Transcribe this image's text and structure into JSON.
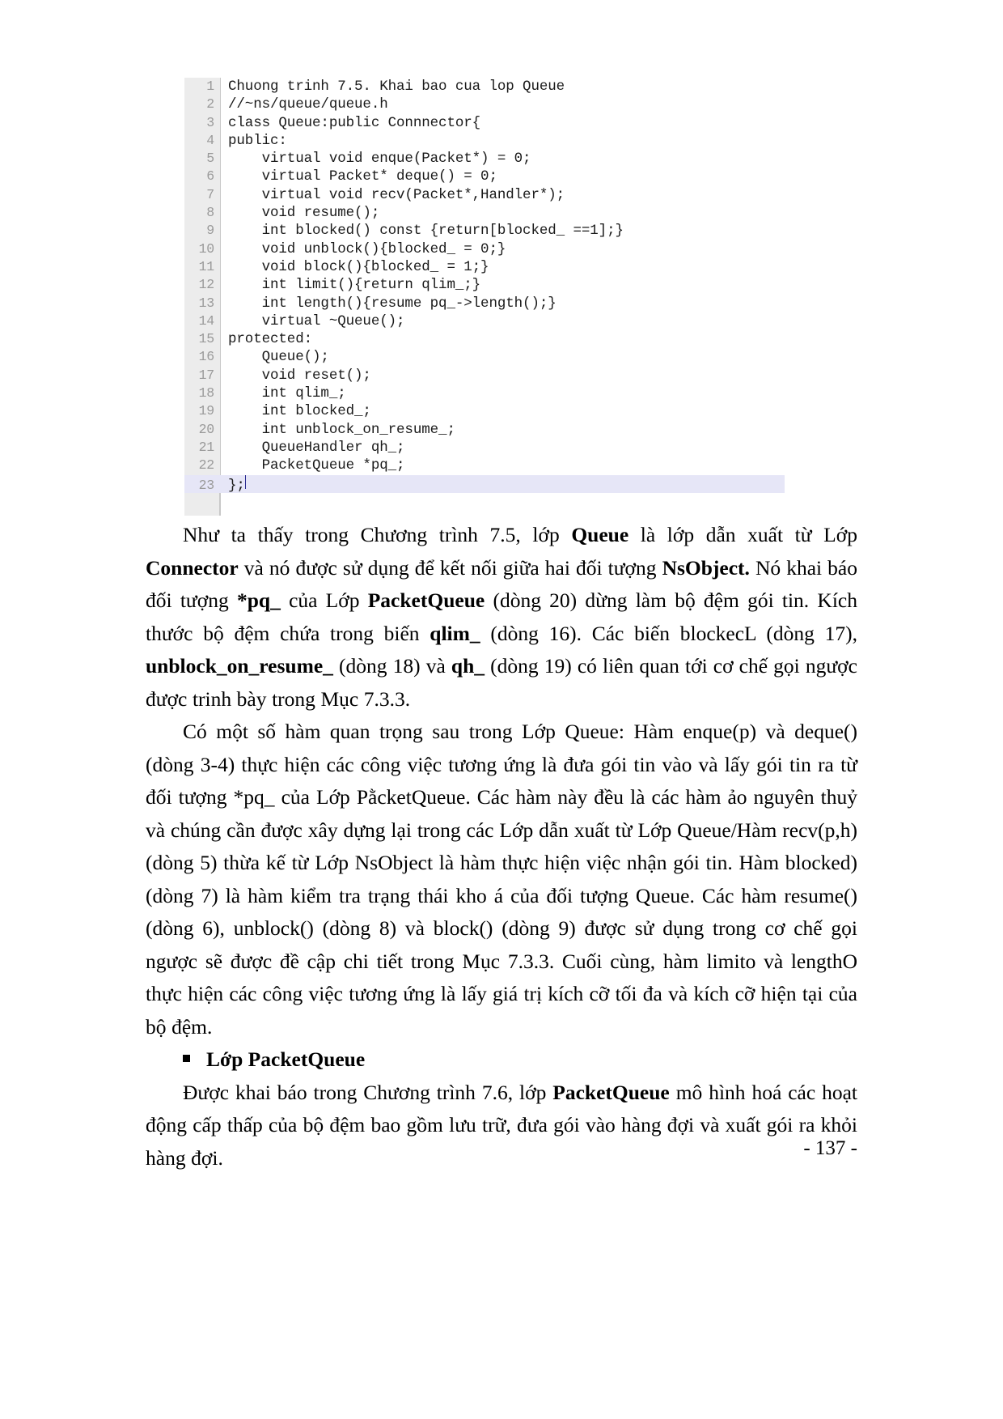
{
  "code_listing": {
    "language": "cpp",
    "highlighted_line": 23,
    "lines": [
      {
        "n": "1",
        "text": "Chuong trinh 7.5. Khai bao cua lop Queue"
      },
      {
        "n": "2",
        "text": "//~ns/queue/queue.h"
      },
      {
        "n": "3",
        "text": "class Queue:public Connnector{"
      },
      {
        "n": "4",
        "text": "public:"
      },
      {
        "n": "5",
        "text": "    virtual void enque(Packet*) = 0;"
      },
      {
        "n": "6",
        "text": "    virtual Packet* deque() = 0;"
      },
      {
        "n": "7",
        "text": "    virtual void recv(Packet*,Handler*);"
      },
      {
        "n": "8",
        "text": "    void resume();"
      },
      {
        "n": "9",
        "text": "    int blocked() const {return[blocked_ ==1];}"
      },
      {
        "n": "10",
        "text": "    void unblock(){blocked_ = 0;}"
      },
      {
        "n": "11",
        "text": "    void block(){blocked_ = 1;}"
      },
      {
        "n": "12",
        "text": "    int limit(){return qlim_;}"
      },
      {
        "n": "13",
        "text": "    int length(){resume pq_->length();}"
      },
      {
        "n": "14",
        "text": "    virtual ~Queue();"
      },
      {
        "n": "15",
        "text": "protected:"
      },
      {
        "n": "16",
        "text": "    Queue();"
      },
      {
        "n": "17",
        "text": "    void reset();"
      },
      {
        "n": "18",
        "text": "    int qlim_;"
      },
      {
        "n": "19",
        "text": "    int blocked_;"
      },
      {
        "n": "20",
        "text": "    int unblock_on_resume_;"
      },
      {
        "n": "21",
        "text": "    QueueHandler qh_;"
      },
      {
        "n": "22",
        "text": "    PacketQueue *pq_;"
      },
      {
        "n": "23",
        "text": "};"
      }
    ]
  },
  "paragraphs": {
    "p1": {
      "seg1": "Như ta thấy trong Chương trình 7.5, lớp ",
      "b1": "Queue",
      "seg2": " là lớp dẫn xuất từ Lớp ",
      "b2": "Connector",
      "seg3": " và nó được sử dụng để kết nối giữa hai đối tượng ",
      "b3": "NsObject.",
      "seg4": " Nó khai báo đối tượng ",
      "b4": "*pq_",
      "seg5": " của Lớp ",
      "b5": "PacketQueue",
      "seg6": " (dòng 20) dừng làm bộ đệm gói tin. Kích thước bộ đệm chứa trong biến ",
      "b6": "qlim_",
      "seg7": " (dòng 16). Các biến blockecL (dòng 17), ",
      "b7": "unblock_on_resume_",
      "seg8": " (dòng 18) và ",
      "b8": "qh_",
      "seg9": " (dòng 19) có liên quan tới cơ chế gọi ngược được trinh bày trong Mục 7.3.3."
    },
    "p2": {
      "text": "Có một số hàm quan trọng sau trong Lớp Queue: Hàm enque(p) và deque() (dòng 3-4) thực hiện các công việc tương ứng là đưa gói tin vào và lấy gói tin ra từ đối tượng *pq_ của Lớp PằcketQueue. Các hàm này đều là các hàm ảo nguyên thuỷ và chúng cần được xây dựng lại trong các Lớp dẫn xuất từ Lớp Queue/Hàm recv(p,h) (dòng 5) thừa kế từ Lớp NsObject là hàm thực hiện việc nhận gói tin. Hàm blocked) (dòng 7) là hàm kiểm tra trạng thái kho á của đối tượng Queue. Các hàm resume() (dòng 6), unblock() (dòng 8) và block() (dòng 9) được sử dụng trong cơ chế gọi ngược sẽ được đề cập chi tiết trong Mục 7.3.3. Cuối cùng, hàm limito và lengthO thực hiện các công việc tương ứng là lấy giá trị kích cỡ tối đa và kích cỡ hiện tại của bộ đệm."
    },
    "bullet_heading": "Lớp PacketQueue",
    "p3": {
      "seg1": "Được khai báo trong Chương trình 7.6, lớp ",
      "b1": "PacketQueue",
      "seg2": " mô hình hoá các hoạt động cấp thấp của bộ đệm bao gồm lưu trữ, đưa gói vào hàng đợi và xuất gói ra khỏi hàng đợi."
    }
  },
  "footer": {
    "page_number": "- 137 -"
  },
  "colors": {
    "gutter_bg": "#ececec",
    "gutter_text": "#9a9a9a",
    "highlight_row": "#e6e6f7",
    "caret": "#2b2b90",
    "text": "#000000",
    "page_bg": "#ffffff"
  }
}
